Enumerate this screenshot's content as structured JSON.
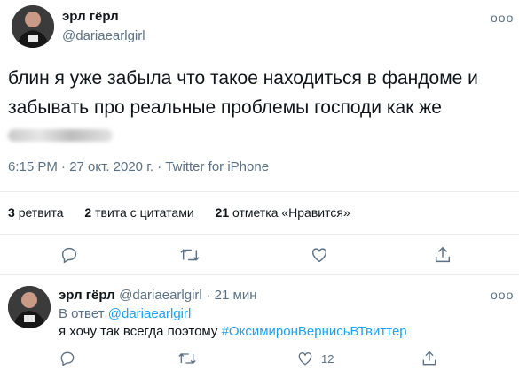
{
  "tweet": {
    "author_name": "эрл гёрл",
    "author_handle": "@dariaearlgirl",
    "more_label": "ooo",
    "text": "блин я уже забыла что такое находиться в фандоме и забывать про реальные проблемы господи как же",
    "time": "6:15 PM · 27 окт. 2020 г. · Twitter for iPhone"
  },
  "stats": {
    "retweets_count": "3",
    "retweets_label": "ретвита",
    "quotes_count": "2",
    "quotes_label": "твита с цитатами",
    "likes_count": "21",
    "likes_label": "отметка «Нравится»"
  },
  "reply": {
    "author_name": "эрл гёрл",
    "author_handle": "@dariaearlgirl",
    "dot": "·",
    "time": "21 мин",
    "more_label": "ooo",
    "reply_to_prefix": "В ответ",
    "reply_to_handle": "@dariaearlgirl",
    "text_plain": "я хочу так всегда поэтому",
    "hashtag": "#ОксимиронВернисьВТвиттер",
    "like_count": "12"
  },
  "colors": {
    "accent": "#1da1f2",
    "muted": "#5b7083",
    "text": "#0f1419",
    "divider": "#ebeef0"
  },
  "icons": [
    "reply-icon",
    "retweet-icon",
    "like-icon",
    "share-icon"
  ]
}
